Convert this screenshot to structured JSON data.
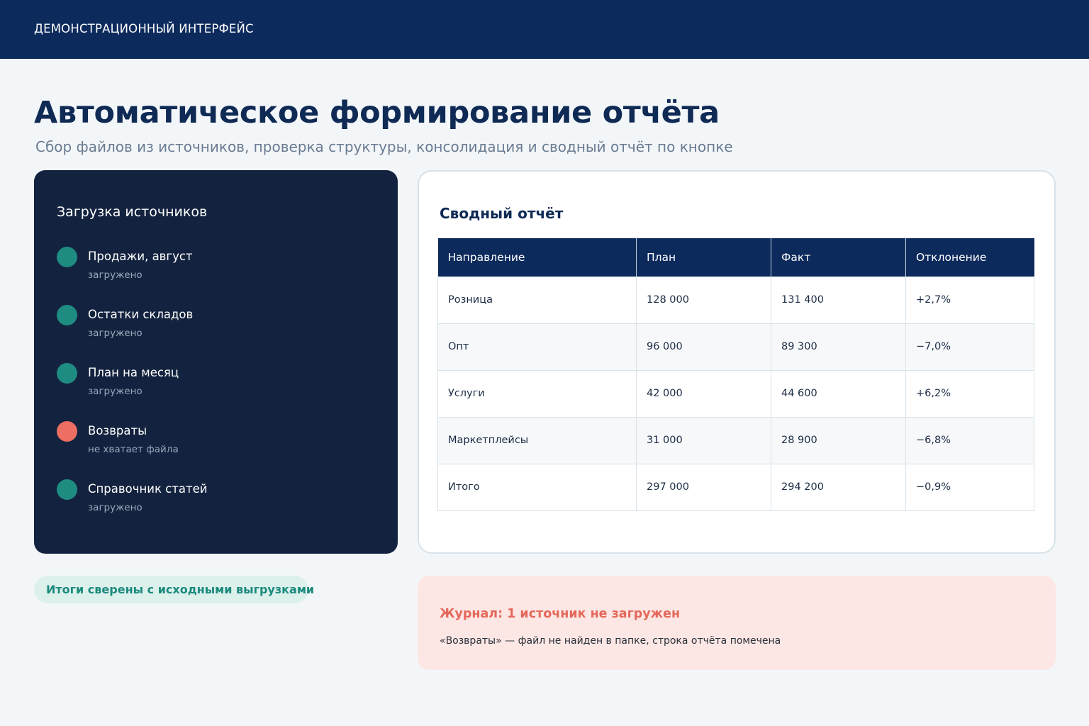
{
  "header": {
    "title": "ДЕМОНСТРАЦИОННЫЙ ИНТЕРФЕЙС"
  },
  "page": {
    "title": "Автоматическое формирование отчёта",
    "subtitle": "Сбор файлов из источников, проверка структуры, консолидация и сводный отчёт по кнопке"
  },
  "sources": {
    "title": "Загрузка источников",
    "items": [
      {
        "name": "Продажи, август",
        "status": "загружено",
        "color": "#1e8c80"
      },
      {
        "name": "Остатки складов",
        "status": "загружено",
        "color": "#1e8c80"
      },
      {
        "name": "План на месяц",
        "status": "загружено",
        "color": "#1e8c80"
      },
      {
        "name": "Возвраты",
        "status": "не хватает файла",
        "color": "#ed6e62"
      },
      {
        "name": "Справочник статей",
        "status": "загружено",
        "color": "#1e8c80"
      }
    ]
  },
  "report": {
    "title": "Сводный отчёт",
    "columns": [
      "Направление",
      "План",
      "Факт",
      "Отклонение"
    ],
    "rows": [
      [
        "Розница",
        "128 000",
        "131 400",
        "+2,7%"
      ],
      [
        "Опт",
        "96 000",
        "89 300",
        "−7,0%"
      ],
      [
        "Услуги",
        "42 000",
        "44 600",
        "+6,2%"
      ],
      [
        "Маркетплейсы",
        "31 000",
        "28 900",
        "−6,8%"
      ],
      [
        "Итого",
        "297 000",
        "294 200",
        "−0,9%"
      ]
    ]
  },
  "badge": {
    "text": "Итоги сверены с исходными выгрузками"
  },
  "log": {
    "title": "Журнал: 1 источник не загружен",
    "message": "«Возвраты» — файл не найден в папке, строка отчёта помечена"
  }
}
